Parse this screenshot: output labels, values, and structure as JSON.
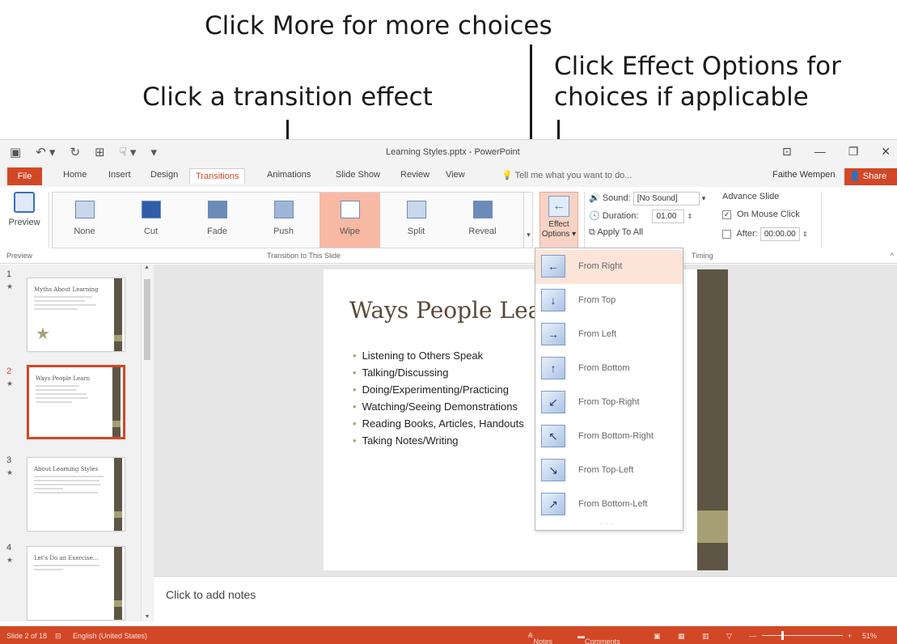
{
  "callouts": {
    "more": "Click More for more choices",
    "effect_line1": "Click Effect Options for",
    "effect_line2": "choices if applicable",
    "transition": "Click a transition effect"
  },
  "window": {
    "title": "Learning Styles.pptx - PowerPoint",
    "qat": [
      "save-icon",
      "undo-icon",
      "redo-icon",
      "start-presentation-icon",
      "touch-mode-icon"
    ],
    "controls": [
      "ribbon-display-icon",
      "minimize-icon",
      "restore-icon",
      "close-icon"
    ]
  },
  "tabs": {
    "file": "File",
    "items": [
      "Home",
      "Insert",
      "Design",
      "Transitions",
      "Animations",
      "Slide Show",
      "Review",
      "View"
    ],
    "active": "Transitions",
    "tell_me": "Tell me what you want to do...",
    "user": "Faithe Wempen",
    "share": "Share"
  },
  "ribbon": {
    "preview_label": "Preview",
    "preview_group": "Preview",
    "transition_group": "Transition to This Slide",
    "timing_group": "Timing",
    "gallery": [
      "None",
      "Cut",
      "Fade",
      "Push",
      "Wipe",
      "Split",
      "Reveal"
    ],
    "selected_transition": "Wipe",
    "effect_options_line1": "Effect",
    "effect_options_line2": "Options",
    "sound_label": "Sound:",
    "sound_value": "[No Sound]",
    "duration_label": "Duration:",
    "duration_value": "01.00",
    "apply_all": "Apply To All",
    "advance_slide": "Advance Slide",
    "on_mouse_click": "On Mouse Click",
    "on_mouse_click_checked": true,
    "after_label": "After:",
    "after_value": "00:00.00"
  },
  "thumbnails": [
    {
      "number": "1",
      "title": "Myths About Learning",
      "star": true
    },
    {
      "number": "2",
      "title": "Ways People Learn",
      "selected": true
    },
    {
      "number": "3",
      "title": "About Learning Styles"
    },
    {
      "number": "4",
      "title": "Let's Do an Exercise..."
    }
  ],
  "slide": {
    "title": "Ways People Learn",
    "bullets": [
      "Listening to Others Speak",
      "Talking/Discussing",
      "Doing/Experimenting/Practicing",
      "Watching/Seeing Demonstrations",
      "Reading Books, Articles, Handouts",
      "Taking Notes/Writing"
    ]
  },
  "notes_placeholder": "Click to add notes",
  "effect_options": [
    {
      "label": "From Right",
      "icon": "arrow-left-icon",
      "glyph": "←",
      "selected": true
    },
    {
      "label": "From Top",
      "icon": "arrow-down-icon",
      "glyph": "↓"
    },
    {
      "label": "From Left",
      "icon": "arrow-right-icon",
      "glyph": "→"
    },
    {
      "label": "From Bottom",
      "icon": "arrow-up-icon",
      "glyph": "↑"
    },
    {
      "label": "From Top-Right",
      "icon": "arrow-down-left-icon",
      "glyph": "↙"
    },
    {
      "label": "From Bottom-Right",
      "icon": "arrow-up-left-icon",
      "glyph": "↖"
    },
    {
      "label": "From Top-Left",
      "icon": "arrow-down-right-icon",
      "glyph": "↘"
    },
    {
      "label": "From Bottom-Left",
      "icon": "arrow-up-right-icon",
      "glyph": "↗"
    }
  ],
  "status": {
    "slide_count": "Slide 2 of 18",
    "language": "English (United States)",
    "notes": "Notes",
    "comments": "Comments",
    "zoom": "51%"
  },
  "colors": {
    "accent": "#d24726",
    "slide_bar": "#5e5544",
    "slide_accent": "#a69f73"
  }
}
